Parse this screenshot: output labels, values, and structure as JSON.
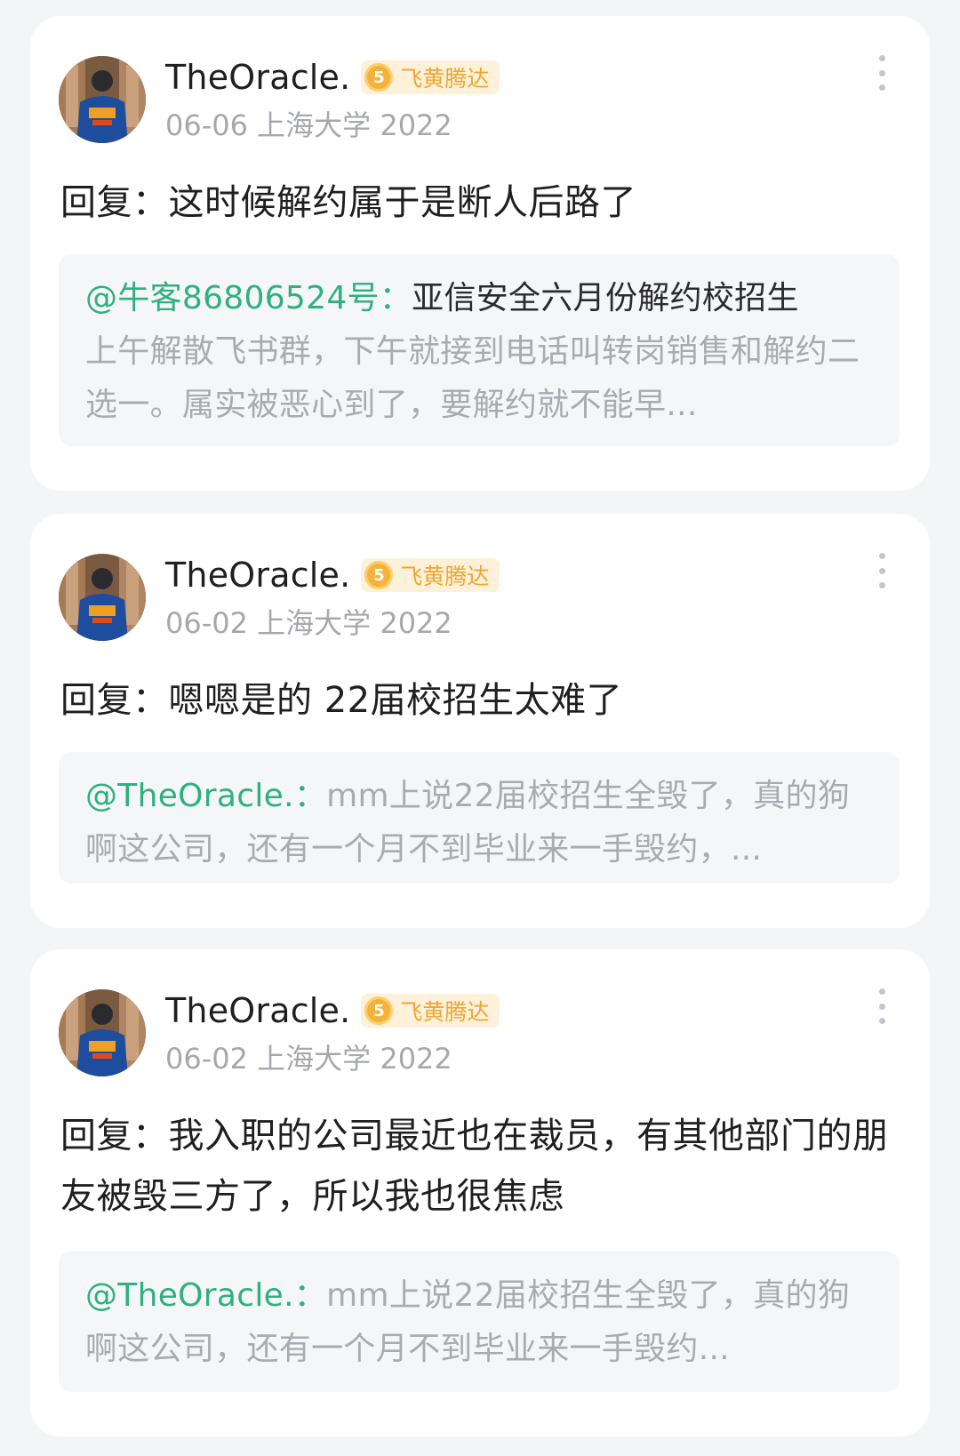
{
  "posts": [
    {
      "author": "TheOracle.",
      "level": "5",
      "badge": "飞黄腾达",
      "date_school": "06-06 上海大学 2022",
      "reply": "回复：这时候解约属于是断人后路了",
      "quote": {
        "mention": "@牛客86806524号：",
        "lead": "亚信安全六月份解约校招生",
        "rest": "上午解散飞书群，下午就接到电话叫转岗销售和解约二选一。属实被恶心到了，要解约就不能早..."
      }
    },
    {
      "author": "TheOracle.",
      "level": "5",
      "badge": "飞黄腾达",
      "date_school": "06-02 上海大学 2022",
      "reply": "回复：嗯嗯是的 22届校招生太难了",
      "quote": {
        "mention": "@TheOracle.：",
        "lead": "",
        "rest": "mm上说22届校招生全毁了，真的狗啊这公司，还有一个月不到毕业来一手毁约，..."
      }
    },
    {
      "author": "TheOracle.",
      "level": "5",
      "badge": "飞黄腾达",
      "date_school": "06-02 上海大学 2022",
      "reply": "回复：我入职的公司最近也在裁员，有其他部门的朋友被毁三方了，所以我也很焦虑",
      "quote": {
        "mention": "@TheOracle.：",
        "lead": "",
        "rest": "mm上说22届校招生全毁了，真的狗啊这公司，还有一个月不到毕业来一手毁约..."
      }
    }
  ]
}
